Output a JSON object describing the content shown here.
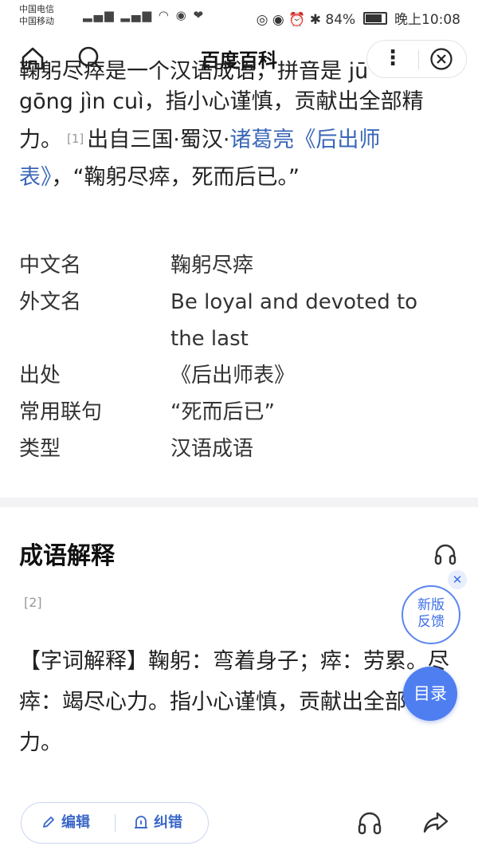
{
  "status_bar": {
    "carrier1": "中国电信",
    "carrier2": "中国移动",
    "battery": "84%",
    "time": "晚上10:08"
  },
  "nav": {
    "title": "百度百科"
  },
  "summary": {
    "top_line": "鞠躬尽瘁是一个汉语成语，拼音是 jū",
    "line2": "gōng jìn cuì，指小心谨慎，贡献出全部精",
    "line3_a": "力。",
    "ref": "[1]",
    "line3_b": "出自三国·蜀汉·",
    "link": "诸葛亮《后出师",
    "link2": "表》",
    "line4": "，“鞠躬尽瘁，死而后已。”"
  },
  "infobox": [
    {
      "key": "中文名",
      "value": "鞠躬尽瘁"
    },
    {
      "key": "外文名",
      "value": "Be loyal and devoted to the last"
    },
    {
      "key": "出处",
      "value": "《后出师表》"
    },
    {
      "key": "常用联句",
      "value": "“死而后已”"
    },
    {
      "key": "类型",
      "value": "汉语成语"
    }
  ],
  "section": {
    "title": "成语解释",
    "ref": "[2]",
    "body": "【字词解释】鞠躬：弯着身子；瘁：劳累。尽瘁：竭尽心力。指小心谨慎，贡献出全部精力。"
  },
  "floating": {
    "feedback_line1": "新版",
    "feedback_line2": "反馈",
    "toc": "目录"
  },
  "bottom_bar": {
    "edit": "编辑",
    "correct": "纠错"
  }
}
